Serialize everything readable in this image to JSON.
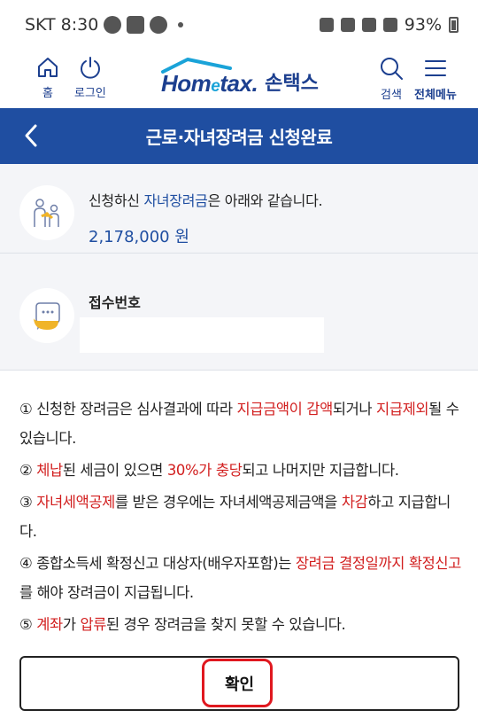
{
  "status_bar": {
    "carrier": "SKT",
    "time": "8:30",
    "icons_left": [
      "moon-icon",
      "gallery-icon",
      "talk-icon"
    ],
    "icons_right": [
      "alarm-icon",
      "location-icon",
      "5g-icon",
      "signal-icon"
    ],
    "battery": "93%"
  },
  "header": {
    "home_label": "홈",
    "login_label": "로그인",
    "logo_text_en_1": "Hom",
    "logo_text_en_e": "e",
    "logo_text_en_2": "tax.",
    "logo_text_ko": "손택스",
    "search_label": "검색",
    "menu_label": "전체메뉴",
    "colors": {
      "brand": "#1c3f8f",
      "accent": "#1aa3d8"
    }
  },
  "title_bar": {
    "title": "근로·자녀장려금 신청완료",
    "color": "#1f4ea1"
  },
  "application": {
    "prefix": "신청하신 ",
    "type": "자녀장려금",
    "suffix": "은 아래와 같습니다.",
    "amount": "2,178,000 원"
  },
  "receipt": {
    "label": "접수번호",
    "value": ""
  },
  "notices": [
    [
      {
        "t": "① 신청한 장려금은 심사결과에 따라 "
      },
      {
        "t": "지급금액이 감액",
        "red": true
      },
      {
        "t": "되거나 "
      },
      {
        "t": "지급제외",
        "red": true
      },
      {
        "t": "될 수 있습니다."
      }
    ],
    [
      {
        "t": "② "
      },
      {
        "t": "체납",
        "red": true
      },
      {
        "t": "된 세금이 있으면 "
      },
      {
        "t": "30%가 충당",
        "red": true
      },
      {
        "t": "되고 나머지만 지급합니다."
      }
    ],
    [
      {
        "t": "③ "
      },
      {
        "t": "자녀세액공제",
        "red": true
      },
      {
        "t": "를 받은 경우에는 자녀세액공제금액을 "
      },
      {
        "t": "차감",
        "red": true
      },
      {
        "t": "하고 지급합니다."
      }
    ],
    [
      {
        "t": "④ 종합소득세 확정신고 대상자(배우자포함)는 "
      },
      {
        "t": "장려금 결정일까지 확정신고",
        "red": true
      },
      {
        "t": "를 해야 장려금이 지급됩니다."
      }
    ],
    [
      {
        "t": "⑤ "
      },
      {
        "t": "계좌",
        "red": true
      },
      {
        "t": "가 "
      },
      {
        "t": "압류",
        "red": true
      },
      {
        "t": "된 경우 장려금을 찾지 못할 수 있습니다."
      }
    ]
  ],
  "confirm": {
    "label": "확인",
    "highlight_color": "#e0181f"
  }
}
